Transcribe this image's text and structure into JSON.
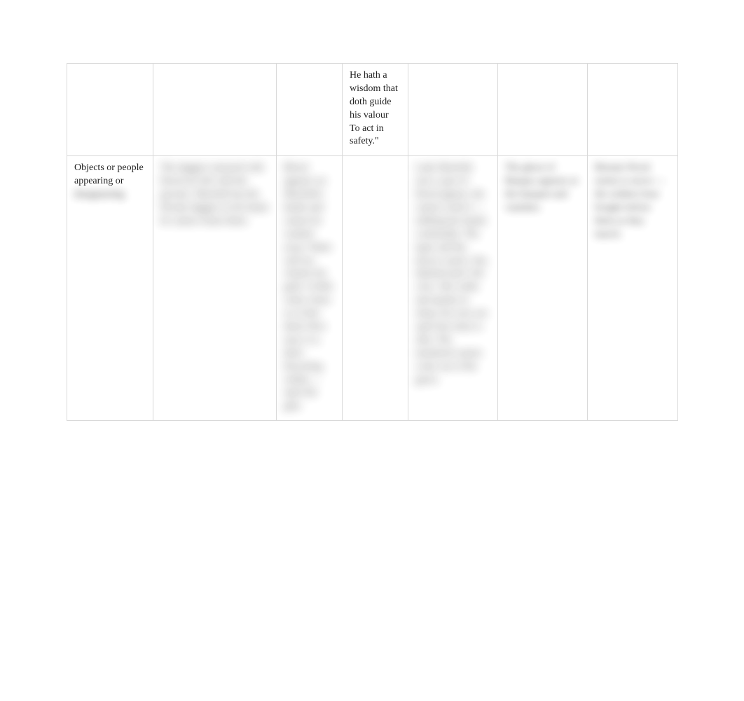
{
  "colors": {
    "border": "#d9d9d9",
    "text": "#222222",
    "background": "#ffffff"
  },
  "row1": {
    "c1": "",
    "c2": "",
    "c3": "",
    "c4": "He hath a wisdom that doth guide his valour\nTo act in safety.\"",
    "c5": "",
    "c6": "",
    "c7": ""
  },
  "row2": {
    "label_clear": "Objects or people appearing or",
    "label_blurred": "disappearing",
    "c2": "The daggers smeared with blood are left with the grooms. Macbeth has the bloody daggers in his hand; he cannot return them.",
    "c3": "Blood appears on Macbeth's hands and cannot be washed away. Water will not cleanse his guilt. A little water clears us of this deed; How easy is it, then! Knocking within — open the gate.",
    "c4": "",
    "c5": "Lady Macbeth sees a spot of blood appear; she cannot wash it — rubbing her hands continually. The taper and the doctor watch. Out, damned spot! she cries. She walks and speaks in sleep; her eyes are open but sense is shut. The murdered cannot come out of the grave.",
    "c6": "The ghost of Banquo appears at the banquet and vanishes.",
    "c7": "Birnam Wood seems to move — the soldiers bear boughs before them as they march."
  }
}
